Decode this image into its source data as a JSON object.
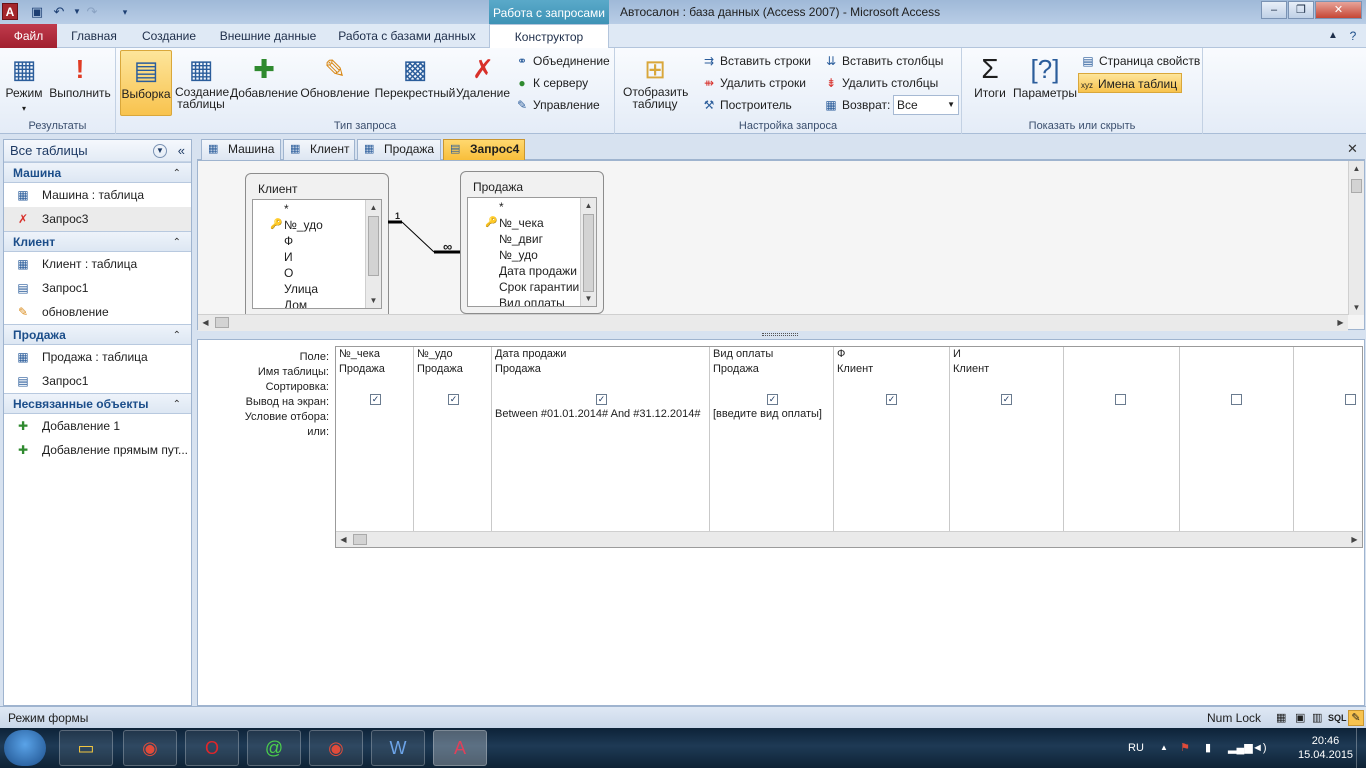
{
  "titlebar": {
    "context_title": "Работа с запросами",
    "window_title": "Автосалон : база данных (Access 2007)  -  Microsoft Access"
  },
  "ribbon_tabs": {
    "file": "Файл",
    "home": "Главная",
    "create": "Создание",
    "external": "Внешние данные",
    "database": "Работа с базами данных",
    "designer": "Конструктор"
  },
  "ribbon": {
    "results": {
      "label": "Результаты",
      "view": "Режим",
      "run": "Выполнить"
    },
    "query_type": {
      "label": "Тип запроса",
      "select": "Выборка",
      "make_table": "Создание таблицы",
      "append": "Добавление",
      "update": "Обновление",
      "crosstab": "Перекрестный",
      "delete": "Удаление",
      "union": "Объединение",
      "pass_through": "К серверу",
      "data_def": "Управление"
    },
    "setup": {
      "label": "Настройка запроса",
      "show_table": "Отобразить таблицу",
      "insert_rows": "Вставить строки",
      "delete_rows": "Удалить строки",
      "builder": "Построитель",
      "insert_cols": "Вставить столбцы",
      "delete_cols": "Удалить столбцы",
      "return_label": "Возврат:",
      "return_value": "Все"
    },
    "show_hide": {
      "label": "Показать или скрыть",
      "totals": "Итоги",
      "params": "Параметры",
      "property_sheet": "Страница свойств",
      "table_names": "Имена таблиц"
    }
  },
  "nav": {
    "header": "Все таблицы",
    "groups": [
      {
        "title": "Машина",
        "items": [
          {
            "label": "Машина : таблица",
            "icon": "table-icon"
          },
          {
            "label": "Запрос3",
            "icon": "delete-query-icon"
          }
        ]
      },
      {
        "title": "Клиент",
        "items": [
          {
            "label": "Клиент : таблица",
            "icon": "table-icon"
          },
          {
            "label": "Запрос1",
            "icon": "query-icon"
          },
          {
            "label": "обновление",
            "icon": "update-query-icon"
          }
        ]
      },
      {
        "title": "Продажа",
        "items": [
          {
            "label": "Продажа : таблица",
            "icon": "table-icon"
          },
          {
            "label": "Запрос1",
            "icon": "query-icon"
          }
        ]
      },
      {
        "title": "Несвязанные объекты",
        "items": [
          {
            "label": "Добавление 1",
            "icon": "append-query-icon"
          },
          {
            "label": "Добавление прямым пут...",
            "icon": "append-query-icon"
          }
        ]
      }
    ]
  },
  "doc_tabs": [
    "Машина",
    "Клиент",
    "Продажа",
    "Запрос4"
  ],
  "field_lists": {
    "client": {
      "title": "Клиент",
      "fields": [
        "*",
        "№_удо",
        "Ф",
        "И",
        "О",
        "Улица",
        "Дом"
      ]
    },
    "sale": {
      "title": "Продажа",
      "fields": [
        "*",
        "№_чека",
        "№_двиг",
        "№_удо",
        "Дата продажи",
        "Срок гарантии",
        "Вид оплаты"
      ]
    },
    "relation": {
      "one": "1",
      "many": "∞"
    }
  },
  "grid": {
    "row_labels": [
      "Поле:",
      "Имя таблицы:",
      "Сортировка:",
      "Вывод на экран:",
      "Условие отбора:",
      "или:"
    ],
    "columns": [
      {
        "field": "№_чека",
        "table": "Продажа",
        "show": true,
        "criteria": ""
      },
      {
        "field": "№_удо",
        "table": "Продажа",
        "show": true,
        "criteria": ""
      },
      {
        "field": "Дата продажи",
        "table": "Продажа",
        "show": true,
        "criteria": "Between #01.01.2014# And #31.12.2014#"
      },
      {
        "field": "Вид оплаты",
        "table": "Продажа",
        "show": true,
        "criteria": "[введите вид оплаты]"
      },
      {
        "field": "Ф",
        "table": "Клиент",
        "show": true,
        "criteria": ""
      },
      {
        "field": "И",
        "table": "Клиент",
        "show": true,
        "criteria": ""
      },
      {
        "field": "",
        "table": "",
        "show": false,
        "criteria": ""
      },
      {
        "field": "",
        "table": "",
        "show": false,
        "criteria": ""
      },
      {
        "field": "",
        "table": "",
        "show": false,
        "criteria": ""
      }
    ]
  },
  "status": {
    "left": "Режим формы",
    "num_lock": "Num Lock",
    "sql": "SQL"
  },
  "taskbar": {
    "lang": "RU",
    "time": "20:46",
    "date": "15.04.2015"
  }
}
